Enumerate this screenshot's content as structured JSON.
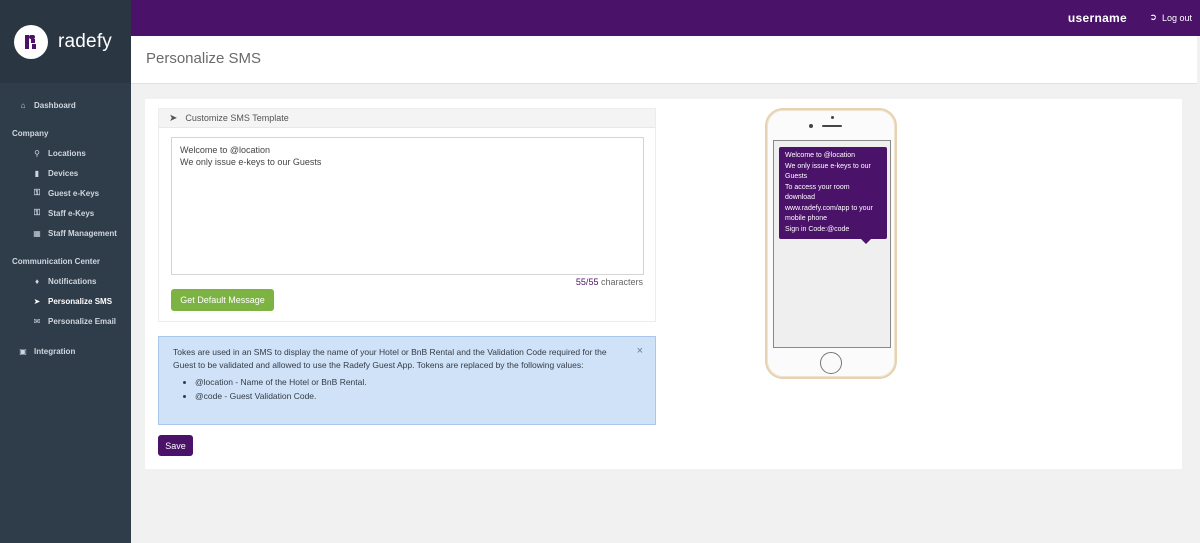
{
  "app": {
    "brand": "radefy"
  },
  "topbar": {
    "username": "username",
    "logout_label": "Log out"
  },
  "sidebar": {
    "dashboard": "Dashboard",
    "company_section": "Company",
    "company_items": [
      {
        "label": "Locations",
        "icon": "map-marker-icon"
      },
      {
        "label": "Devices",
        "icon": "device-icon"
      },
      {
        "label": "Guest e-Keys",
        "icon": "key-icon"
      },
      {
        "label": "Staff e-Keys",
        "icon": "key-icon"
      },
      {
        "label": "Staff Management",
        "icon": "building-icon"
      }
    ],
    "communication_section": "Communication Center",
    "communication_items": [
      {
        "label": "Notifications",
        "icon": "bell-icon"
      },
      {
        "label": "Personalize SMS",
        "icon": "paper-plane-icon",
        "active": true
      },
      {
        "label": "Personalize Email",
        "icon": "envelope-icon"
      }
    ],
    "integration": "Integration"
  },
  "page": {
    "title": "Personalize SMS"
  },
  "template_panel": {
    "title": "Customize SMS Template",
    "message_lines": [
      "Welcome to @location",
      "We only issue e-keys to our Guests"
    ],
    "count_current": "55",
    "count_max": "55",
    "count_suffix": "characters",
    "default_button": "Get Default Message"
  },
  "info_alert": {
    "text": "Tokes are used in an SMS to display the name of your Hotel or BnB Rental and the Validation Code required for the Guest to be validated and allowed to use the Radefy Guest App. Tokens are replaced by the following values:",
    "tokens": [
      "@location - Name of the Hotel or BnB Rental.",
      "@code - Guest Validation Code."
    ],
    "close": "×"
  },
  "save_button": "Save",
  "preview": {
    "lines": [
      "Welcome to @location",
      "We only issue e-keys to our Guests",
      "To access your room download",
      "www.radefy.com/app to your mobile phone",
      "Sign in Code:@code"
    ]
  },
  "colors": {
    "primary": "#4a1269",
    "success": "#7cb342",
    "info": "#cfe2f8",
    "sidebar": "#2f3c4a"
  }
}
